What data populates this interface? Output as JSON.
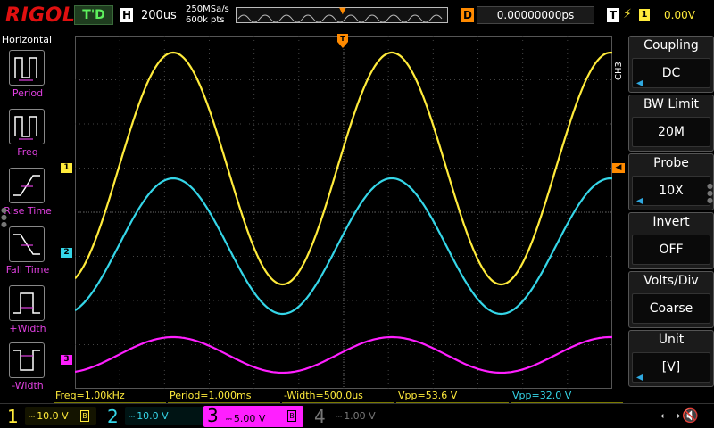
{
  "top_bar": {
    "brand": "RIGOL",
    "trigger_status": "T'D",
    "horizontal_badge": "H",
    "timebase": "200us",
    "sample_rate": "250MSa/s",
    "memory_depth": "600k pts",
    "delay_badge": "D",
    "delay_value": "0.00000000ps",
    "trigger_badge": "T",
    "trigger_source": "1",
    "trigger_level": "0.00V"
  },
  "left_panel": {
    "title": "Horizontal",
    "items": [
      {
        "label": "Period",
        "icon": "period-icon"
      },
      {
        "label": "Freq",
        "icon": "frequency-icon"
      },
      {
        "label": "Rise Time",
        "icon": "rise-time-icon"
      },
      {
        "label": "Fall Time",
        "icon": "fall-time-icon"
      },
      {
        "label": "+Width",
        "icon": "positive-width-icon"
      },
      {
        "label": "-Width",
        "icon": "negative-width-icon"
      }
    ]
  },
  "waveforms": {
    "ch1": {
      "color": "#ffeb3b",
      "marker": "1"
    },
    "ch2": {
      "color": "#35d6e8",
      "marker": "2"
    },
    "ch3": {
      "color": "#ff1fff",
      "marker": "3"
    },
    "trigger_marker": "T"
  },
  "results": [
    {
      "text": "Freq=1.00kHz",
      "color": "#ffeb3b"
    },
    {
      "text": "Period=1.000ms",
      "color": "#ffeb3b"
    },
    {
      "text": "-Width=500.0us",
      "color": "#ffeb3b"
    },
    {
      "text": "Vpp=53.6 V",
      "color": "#ffeb3b"
    },
    {
      "text": "Vpp=32.0 V",
      "color": "#35d6e8"
    }
  ],
  "right_menu": {
    "channel_tab": "CH3",
    "items": [
      {
        "title": "Coupling",
        "value": "DC",
        "knob": true
      },
      {
        "title": "BW Limit",
        "value": "20M",
        "knob": false
      },
      {
        "title": "Probe",
        "value": "10X",
        "knob": true
      },
      {
        "title": "Invert",
        "value": "OFF",
        "knob": false
      },
      {
        "title": "Volts/Div",
        "value": "Coarse",
        "knob": false
      },
      {
        "title": "Unit",
        "value": "[V]",
        "knob": true
      }
    ]
  },
  "channels": [
    {
      "num": "1",
      "scale": "10.0 V",
      "color": "#ffeb3b"
    },
    {
      "num": "2",
      "scale": "10.0 V",
      "color": "#35d6e8"
    },
    {
      "num": "3",
      "scale": "5.00 V",
      "color": "#ff1fff"
    },
    {
      "num": "4",
      "scale": "1.00 V",
      "color": "#777777"
    }
  ]
}
